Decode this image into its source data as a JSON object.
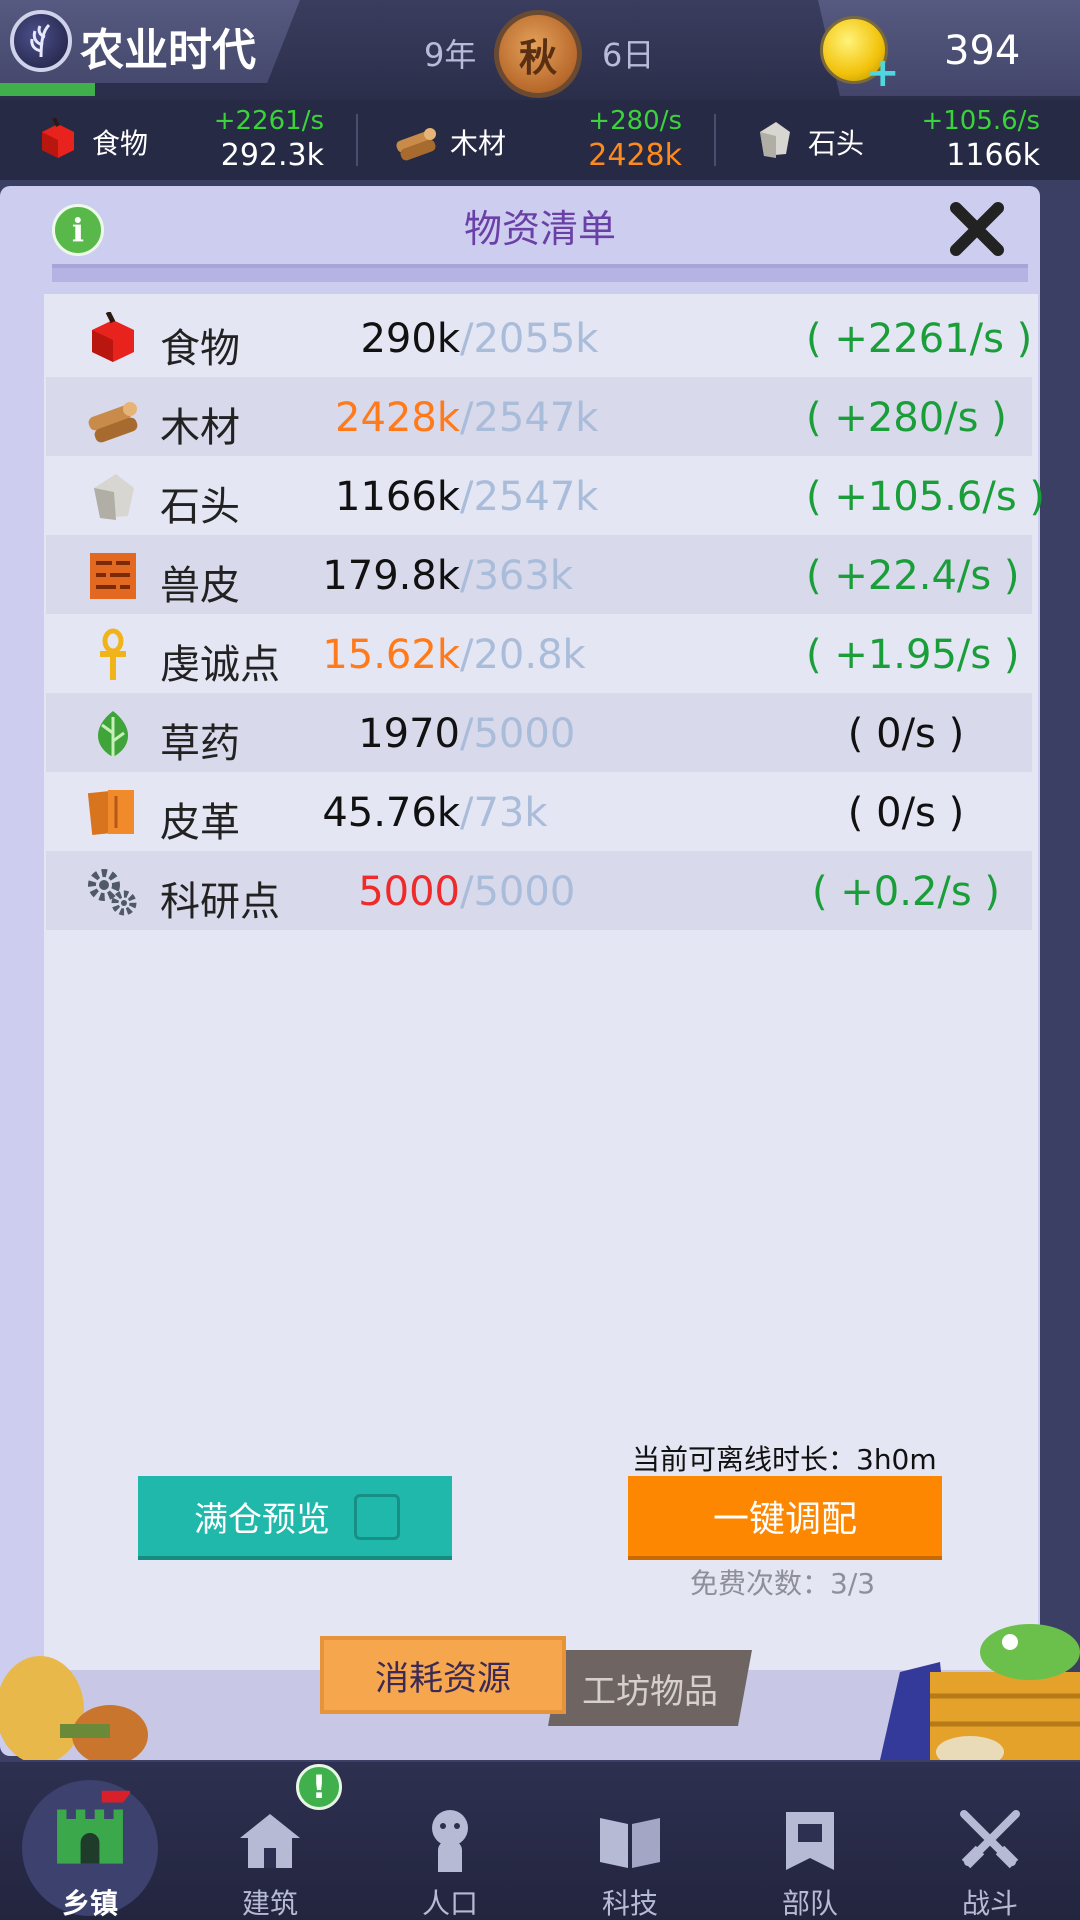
{
  "header": {
    "era_title": "农业时代",
    "era_progress": 0.35,
    "year": "9年",
    "season": "秋",
    "day": "6日",
    "gold": "394"
  },
  "resource_bar": [
    {
      "name": "食物",
      "rate": "+2261/s",
      "amount": "292.3k",
      "amount_color": "#ffffff",
      "icon": "apple-icon"
    },
    {
      "name": "木材",
      "rate": "+280/s",
      "amount": "2428k",
      "amount_color": "#ff8a1c",
      "icon": "wood-icon"
    },
    {
      "name": "石头",
      "rate": "+105.6/s",
      "amount": "1166k",
      "amount_color": "#ffffff",
      "icon": "stone-icon"
    }
  ],
  "panel": {
    "title": "物资清单",
    "rows": [
      {
        "name": "食物",
        "amount": "290k",
        "amount_color": "#111111",
        "cap": "/2055k",
        "rate": "( +2261/s )",
        "rate_color": "#1a9e39",
        "icon": "apple-icon"
      },
      {
        "name": "木材",
        "amount": "2428k",
        "amount_color": "#ff7a1a",
        "cap": "/2547k",
        "rate": "( +280/s )",
        "rate_color": "#1a9e39",
        "icon": "wood-icon"
      },
      {
        "name": "石头",
        "amount": "1166k",
        "amount_color": "#111111",
        "cap": "/2547k",
        "rate": "( +105.6/s )",
        "rate_color": "#1a9e39",
        "icon": "stone-icon"
      },
      {
        "name": "兽皮",
        "amount": "179.8k",
        "amount_color": "#111111",
        "cap": "/363k",
        "rate": "( +22.4/s )",
        "rate_color": "#1a9e39",
        "icon": "hide-icon"
      },
      {
        "name": "虔诚点",
        "amount": "15.62k",
        "amount_color": "#ff7a1a",
        "cap": "/20.8k",
        "rate": "( +1.95/s )",
        "rate_color": "#1a9e39",
        "icon": "ankh-icon"
      },
      {
        "name": "草药",
        "amount": "1970",
        "amount_color": "#111111",
        "cap": "/5000",
        "rate": "( 0/s )",
        "rate_color": "#111111",
        "icon": "herb-icon"
      },
      {
        "name": "皮革",
        "amount": "45.76k",
        "amount_color": "#111111",
        "cap": "/73k",
        "rate": "( 0/s )",
        "rate_color": "#111111",
        "icon": "leather-icon"
      },
      {
        "name": "科研点",
        "amount": "5000",
        "amount_color": "#ee2a2a",
        "cap": "/5000",
        "rate": "( +0.2/s )",
        "rate_color": "#1a9e39",
        "icon": "gears-icon"
      }
    ],
    "offline_time": "当前可离线时长：3h0m",
    "preview_button": "满仓预览",
    "dispatch_button": "一键调配",
    "free_count": "免费次数：3/3",
    "tab_active": "消耗资源",
    "tab_inactive": "工坊物品"
  },
  "nav": [
    {
      "label": "乡镇",
      "icon": "castle-icon",
      "active": true
    },
    {
      "label": "建筑",
      "icon": "house-icon"
    },
    {
      "label": "人口",
      "icon": "person-icon"
    },
    {
      "label": "科技",
      "icon": "book-icon"
    },
    {
      "label": "部队",
      "icon": "banner-icon"
    },
    {
      "label": "战斗",
      "icon": "swords-icon"
    }
  ],
  "nav_badge": "!"
}
